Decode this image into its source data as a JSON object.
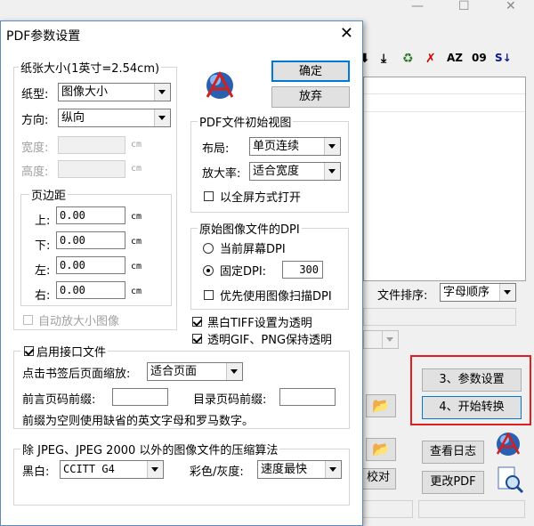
{
  "bg": {
    "title_controls": {
      "minimize": "—",
      "maximize": "☐",
      "close": "✕"
    },
    "toolbar_icons": [
      "down-arrow",
      "download",
      "recycle-bin",
      "delete",
      "sort-az",
      "sort-09",
      "sort-reverse"
    ],
    "toolbar_glyphs": {
      "down": "⬇",
      "download": "⤓",
      "recycle": "♻",
      "delete": "✗",
      "az": "AZ",
      "nine": "09",
      "sz": "S↓"
    },
    "sort_label": "文件排序:",
    "sort_value": "字母顺序",
    "btn_params": "3、参数设置",
    "btn_start": "4、开始转换",
    "btn_log": "查看日志",
    "btn_change_pdf": "更改PDF",
    "btn_check_partial": "校对"
  },
  "dialog": {
    "title": "PDF参数设置",
    "close": "✕",
    "ok": "确定",
    "cancel": "放弃",
    "paper": {
      "title": "纸张大小(1英寸=2.54cm)",
      "type_label": "纸型:",
      "type_value": "图像大小",
      "orient_label": "方向:",
      "orient_value": "纵向",
      "width_label": "宽度:",
      "height_label": "高度:",
      "unit": "cm",
      "margin_title": "页边距",
      "top_label": "上:",
      "bottom_label": "下:",
      "left_label": "左:",
      "right_label": "右:",
      "top": "0.00",
      "bottom": "0.00",
      "left": "0.00",
      "right": "0.00",
      "auto_scale": "自动放大小图像"
    },
    "view": {
      "title": "PDF文件初始视图",
      "layout_label": "布局:",
      "layout_value": "单页连续",
      "zoom_label": "放大率:",
      "zoom_value": "适合宽度",
      "fullscreen": "以全屏方式打开"
    },
    "dpi": {
      "title": "原始图像文件的DPI",
      "screen": "当前屏幕DPI",
      "fixed": "固定DPI:",
      "fixed_value": "300",
      "prefer_scan": "优先使用图像扫描DPI"
    },
    "tiff_transparent": "黑白TIFF设置为透明",
    "gif_png_transparent": "透明GIF、PNG保持透明",
    "interface": {
      "title": "启用接口文件",
      "bookmark_zoom_label": "点击书签后页面缩放:",
      "bookmark_zoom_value": "适合页面",
      "preface_prefix_label": "前言页码前缀:",
      "toc_prefix_label": "目录页码前缀:",
      "note": "前缀为空则使用缺省的英文字母和罗马数字。"
    },
    "compress": {
      "title": "除 JPEG、JPEG 2000 以外的图像文件的压缩算法",
      "bw_label": "黑白:",
      "bw_value": "CCITT G4",
      "color_label": "彩色/灰度:",
      "color_value": "速度最快"
    }
  }
}
